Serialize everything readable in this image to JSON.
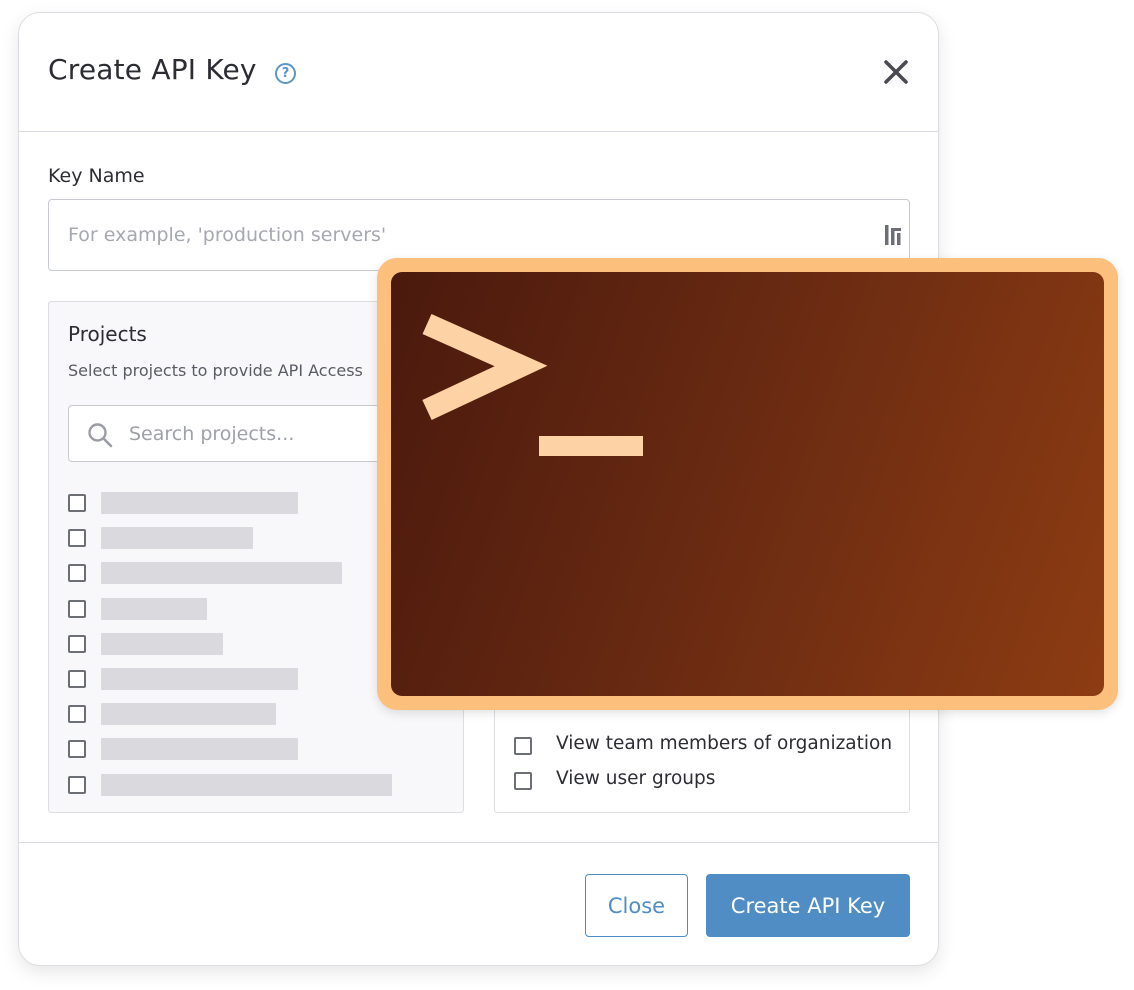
{
  "dialog": {
    "title": "Create API Key",
    "help_icon": "question-circle-icon",
    "close_icon": "close-icon"
  },
  "key_name": {
    "label": "Key Name",
    "placeholder": "For example, 'production servers'",
    "value": ""
  },
  "projects": {
    "title": "Projects",
    "subtitle": "Select projects to provide API Access",
    "search_placeholder": "Search projects...",
    "item_count": 9
  },
  "permissions": {
    "items": [
      {
        "label": "View team members of organization",
        "checked": false
      },
      {
        "label": "View user groups",
        "checked": false
      }
    ]
  },
  "footer": {
    "close_label": "Close",
    "create_label": "Create API Key"
  },
  "overlay": {
    "icon": "terminal-icon"
  },
  "colors": {
    "accent": "#4f8dc4",
    "terminal_frame": "#fdbf7c",
    "terminal_bg_dark": "#4a190d",
    "terminal_bg_light": "#8d3c12",
    "prompt": "#fdd3a6"
  }
}
